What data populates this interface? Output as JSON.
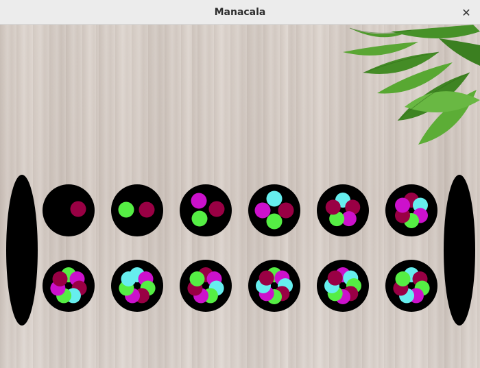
{
  "window": {
    "title": "Manacala",
    "close_icon": "close-icon"
  },
  "colors": {
    "stone_magenta": "#cc11cc",
    "stone_green": "#55ee44",
    "stone_maroon": "#990044",
    "stone_cyan": "#66eeee",
    "pit": "#000000"
  },
  "board": {
    "stores": [
      {
        "side": "left",
        "stones": 0
      },
      {
        "side": "right",
        "stones": 0
      }
    ],
    "top_row": [
      {
        "stones": [
          "maroon"
        ]
      },
      {
        "stones": [
          "green",
          "maroon"
        ]
      },
      {
        "stones": [
          "magenta",
          "maroon",
          "green"
        ]
      },
      {
        "stones": [
          "cyan",
          "magenta",
          "maroon",
          "green"
        ]
      },
      {
        "stones": [
          "cyan",
          "maroon",
          "magenta",
          "green",
          "maroon"
        ]
      },
      {
        "stones": [
          "maroon",
          "cyan",
          "magenta",
          "green",
          "maroon",
          "magenta"
        ]
      }
    ],
    "bottom_row": [
      {
        "stones": [
          "green",
          "magenta",
          "maroon",
          "cyan",
          "green",
          "magenta",
          "maroon"
        ]
      },
      {
        "stones": [
          "cyan",
          "magenta",
          "green",
          "maroon",
          "magenta",
          "green",
          "cyan"
        ]
      },
      {
        "stones": [
          "maroon",
          "magenta",
          "cyan",
          "green",
          "magenta",
          "maroon",
          "green"
        ]
      },
      {
        "stones": [
          "green",
          "magenta",
          "cyan",
          "maroon",
          "green",
          "magenta",
          "cyan",
          "maroon"
        ]
      },
      {
        "stones": [
          "magenta",
          "cyan",
          "green",
          "maroon",
          "magenta",
          "green",
          "cyan",
          "maroon"
        ]
      },
      {
        "stones": [
          "cyan",
          "maroon",
          "green",
          "magenta",
          "cyan",
          "maroon",
          "green"
        ]
      }
    ]
  }
}
